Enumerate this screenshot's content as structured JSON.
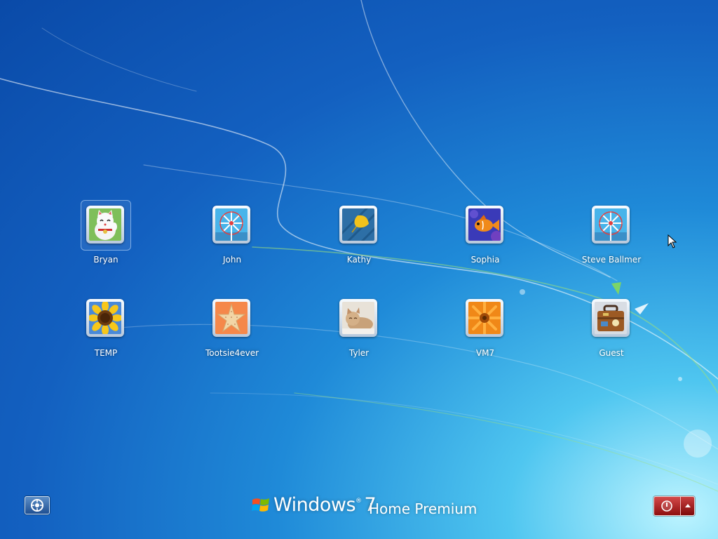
{
  "users": [
    {
      "name": "Bryan",
      "picture": "cat-picture",
      "selected": true
    },
    {
      "name": "John",
      "picture": "pinwheel-picture"
    },
    {
      "name": "Kathy",
      "picture": "leaf-picture"
    },
    {
      "name": "Sophia",
      "picture": "fish-picture"
    },
    {
      "name": "Steve Ballmer",
      "picture": "pinwheel-picture"
    },
    {
      "name": "TEMP",
      "picture": "sunflower-picture"
    },
    {
      "name": "Tootsie4ever",
      "picture": "starfish-picture"
    },
    {
      "name": "Tyler",
      "picture": "kitten-picture"
    },
    {
      "name": "VM7",
      "picture": "gerbera-picture"
    },
    {
      "name": "Guest",
      "picture": "suitcase-picture"
    }
  ],
  "branding": {
    "product": "Windows",
    "version": "7",
    "edition": "Home Premium"
  },
  "controls": {
    "ease_of_access_icon": "ease-of-access-icon",
    "shutdown_icon": "power-icon",
    "shutdown_options_icon": "arrow-up-icon"
  },
  "colors": {
    "background_accent": "#1360c0",
    "shutdown_red": "#b01e1e"
  }
}
